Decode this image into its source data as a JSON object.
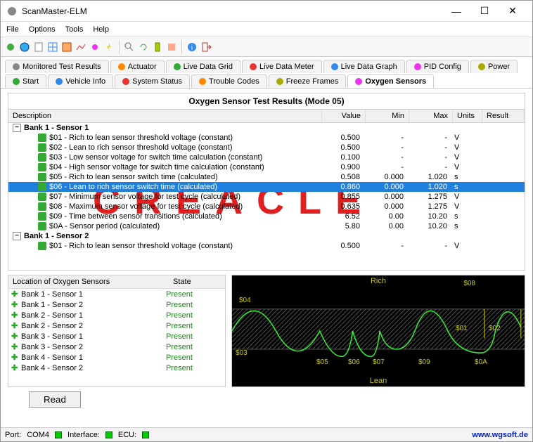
{
  "window": {
    "title": "ScanMaster-ELM"
  },
  "menu": [
    "File",
    "Options",
    "Tools",
    "Help"
  ],
  "tabs_row1": [
    {
      "label": "Monitored Test Results",
      "color": "#888"
    },
    {
      "label": "Actuator",
      "color": "#f80"
    },
    {
      "label": "Live Data Grid",
      "color": "#3a3"
    },
    {
      "label": "Live Data Meter",
      "color": "#e33"
    },
    {
      "label": "Live Data Graph",
      "color": "#38e"
    },
    {
      "label": "PID Config",
      "color": "#e3e"
    },
    {
      "label": "Power",
      "color": "#aa0"
    }
  ],
  "tabs_row2": [
    {
      "label": "Start",
      "color": "#3a3"
    },
    {
      "label": "Vehicle Info",
      "color": "#38e"
    },
    {
      "label": "System Status",
      "color": "#e33"
    },
    {
      "label": "Trouble Codes",
      "color": "#f80"
    },
    {
      "label": "Freeze Frames",
      "color": "#aa0"
    },
    {
      "label": "Oxygen Sensors",
      "color": "#e3e",
      "active": true
    }
  ],
  "panel_title": "Oxygen Sensor Test Results (Mode 05)",
  "grid_headers": {
    "desc": "Description",
    "val": "Value",
    "min": "Min",
    "max": "Max",
    "units": "Units",
    "res": "Result"
  },
  "watermark": "CREACLE",
  "rows": [
    {
      "type": "bank",
      "desc": "Bank 1 - Sensor 1"
    },
    {
      "type": "leaf",
      "desc": "$01 - Rich to lean sensor threshold voltage (constant)",
      "val": "0.500",
      "min": "-",
      "max": "-",
      "units": "V"
    },
    {
      "type": "leaf",
      "desc": "$02 - Lean to rich sensor threshold voltage (constant)",
      "val": "0.500",
      "min": "-",
      "max": "-",
      "units": "V"
    },
    {
      "type": "leaf",
      "desc": "$03 - Low sensor voltage for switch time calculation (constant)",
      "val": "0.100",
      "min": "-",
      "max": "-",
      "units": "V"
    },
    {
      "type": "leaf",
      "desc": "$04 - High sensor voltage for switch time calculation (constant)",
      "val": "0.900",
      "min": "-",
      "max": "-",
      "units": "V"
    },
    {
      "type": "leaf",
      "desc": "$05 - Rich to lean sensor switch time (calculated)",
      "val": "0.508",
      "min": "0.000",
      "max": "1.020",
      "units": "s"
    },
    {
      "type": "leaf",
      "desc": "$06 - Lean to rich sensor switch time (calculated)",
      "val": "0.860",
      "min": "0.000",
      "max": "1.020",
      "units": "s",
      "sel": true
    },
    {
      "type": "leaf",
      "desc": "$07 - Minimum sensor voltage for test cycle (calculated)",
      "val": "0.855",
      "min": "0.000",
      "max": "1.275",
      "units": "V"
    },
    {
      "type": "leaf",
      "desc": "$08 - Maximum sensor voltage for test cycle (calculated)",
      "val": "0.635",
      "min": "0.000",
      "max": "1.275",
      "units": "V"
    },
    {
      "type": "leaf",
      "desc": "$09 - Time between sensor transitions (calculated)",
      "val": "6.52",
      "min": "0.00",
      "max": "10.20",
      "units": "s"
    },
    {
      "type": "leaf",
      "desc": "$0A - Sensor period (calculated)",
      "val": "5.80",
      "min": "0.00",
      "max": "10.20",
      "units": "s"
    },
    {
      "type": "bank",
      "desc": "Bank 1 - Sensor 2"
    },
    {
      "type": "leaf",
      "desc": "$01 - Rich to lean sensor threshold voltage (constant)",
      "val": "0.500",
      "min": "-",
      "max": "-",
      "units": "V"
    }
  ],
  "loc_header": {
    "name": "Location of Oxygen Sensors",
    "state": "State"
  },
  "loc_rows": [
    {
      "name": "Bank 1 - Sensor 1",
      "state": "Present"
    },
    {
      "name": "Bank 1 - Sensor 2",
      "state": "Present"
    },
    {
      "name": "Bank 2 - Sensor 1",
      "state": "Present"
    },
    {
      "name": "Bank 2 - Sensor 2",
      "state": "Present"
    },
    {
      "name": "Bank 3 - Sensor 1",
      "state": "Present"
    },
    {
      "name": "Bank 3 - Sensor 2",
      "state": "Present"
    },
    {
      "name": "Bank 4 - Sensor 1",
      "state": "Present"
    },
    {
      "name": "Bank 4 - Sensor 2",
      "state": "Present"
    }
  ],
  "chart": {
    "rich": "Rich",
    "lean": "Lean",
    "labels": [
      "$01",
      "$02",
      "$03",
      "$04",
      "$05",
      "$06",
      "$07",
      "$08",
      "$09",
      "$0A"
    ]
  },
  "read_btn": "Read",
  "status": {
    "port": "Port:",
    "port_val": "COM4",
    "iface": "Interface:",
    "ecu": "ECU:",
    "link": "www.wgsoft.de"
  }
}
